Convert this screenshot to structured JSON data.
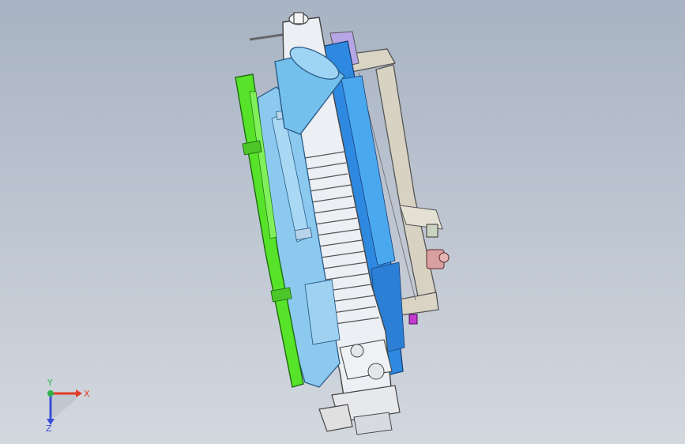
{
  "viewport": {
    "background_top": "#a8b3c3",
    "background_bottom": "#d3d8df"
  },
  "model": {
    "colors": {
      "green_rail": "#57e32a",
      "light_blue_housing": "#8cc9ee",
      "mid_blue_body": "#2d8ae0",
      "white_body": "#eceff3",
      "beige_frame": "#d9d4c4",
      "lavender_plate": "#b7a6e6",
      "pink_fitting": "#d8a0a0",
      "magenta_marker": "#c23ad0"
    }
  },
  "triad": {
    "x_label": "X",
    "y_label": "Y",
    "z_label": "Z",
    "x_color": "#e23a2a",
    "y_color": "#2fb34a",
    "z_color": "#3a4fd8"
  }
}
